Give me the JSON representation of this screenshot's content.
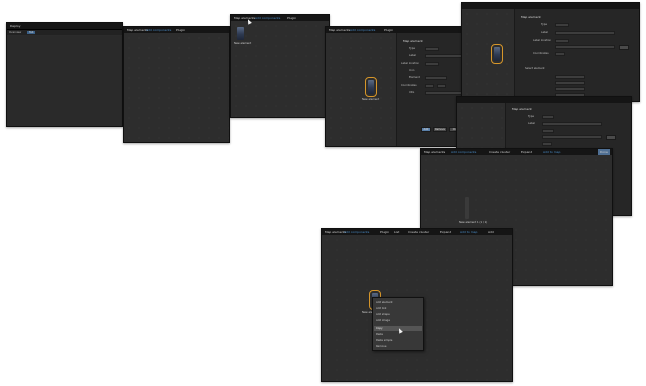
{
  "app": {
    "title": "Deploy"
  },
  "window1": {
    "title": "Deploy",
    "tabs": [
      "Overview",
      "Tab"
    ]
  },
  "toolbar": {
    "items": [
      "Map elements",
      "Add components",
      "Plugin",
      "List",
      "Create cluster",
      "Expand",
      "All",
      "Add to map",
      "Expand ans",
      "Add",
      "Done"
    ]
  },
  "map_element_panel": {
    "title": "Map element",
    "fields": [
      {
        "label": "Type",
        "value": "Router"
      },
      {
        "label": "Label",
        "value": "New element"
      },
      {
        "label": "Label location",
        "value": "Default"
      },
      {
        "label": "Icon",
        "value": ""
      },
      {
        "label": "Element",
        "value": "Device_001"
      },
      {
        "label": "Coordinates",
        "value": "100"
      },
      {
        "label": "URL",
        "value": ""
      }
    ],
    "buttons": [
      "Add",
      "Remove",
      "Close"
    ],
    "section": "Select element"
  },
  "device": {
    "label": "New element",
    "label_alt": "New element 1 (1 / 1)"
  },
  "context_menu": {
    "items": [
      "Add element",
      "Add link",
      "Add shape",
      "Add image",
      "Copy",
      "Paste",
      "Paste simple",
      "Remove"
    ],
    "highlight_index": 4
  },
  "colors": {
    "selection": "#d6962a",
    "accent": "#4a8cc7",
    "background": "#2b2b2b"
  }
}
